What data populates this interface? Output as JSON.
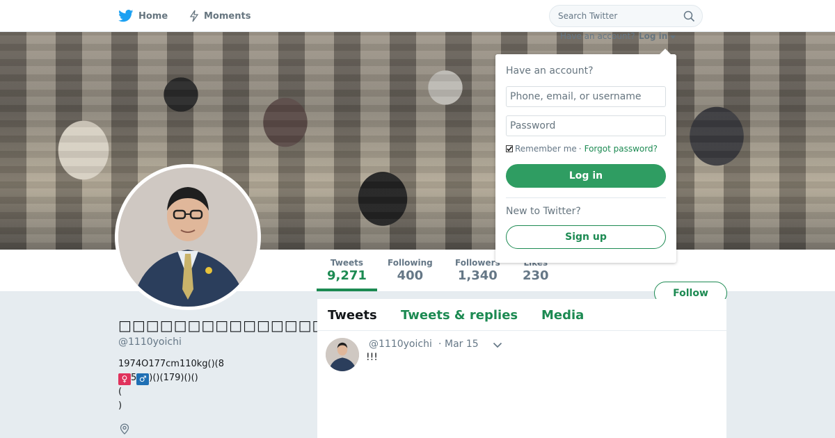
{
  "nav": {
    "home_label": "Home",
    "moments_label": "Moments",
    "search_placeholder": "Search Twitter"
  },
  "login_menu": {
    "have_account_short": "Have an account?",
    "login_link": "Log in",
    "title": "Have an account?",
    "username_placeholder": "Phone, email, or username",
    "password_placeholder": "Password",
    "remember_label": "Remember me",
    "separator": "·",
    "forgot_label": "Forgot password?",
    "login_button": "Log in",
    "new_label": "New to Twitter?",
    "signup_button": "Sign up"
  },
  "stats": [
    {
      "label": "Tweets",
      "value": "9,271",
      "active": true
    },
    {
      "label": "Following",
      "value": "400",
      "active": false
    },
    {
      "label": "Followers",
      "value": "1,340",
      "active": false
    },
    {
      "label": "Likes",
      "value": "230",
      "active": false
    }
  ],
  "follow_button": "Follow",
  "profile": {
    "name": "",
    "handle": "@1110yoichi",
    "bio_line1": "1974O177cm110kg()(8",
    "bio_female_emoji": "♀",
    "bio_mid": "5",
    "bio_male_emoji": "♂",
    "bio_end": ")()(179)()()",
    "bio_line3": "(",
    "bio_line4": ")"
  },
  "timeline": {
    "tabs": [
      "Tweets",
      "Tweets & replies",
      "Media"
    ],
    "tweet": {
      "handle": "@1110yoichi",
      "separator": "·",
      "date": "Mar 15",
      "text": "!!!"
    }
  },
  "colors": {
    "accent": "#1c8a52",
    "twitter_blue": "#1da1f2",
    "background": "#e6ecf0"
  },
  "icons": {
    "home": "twitter-bird-icon",
    "moments": "lightning-icon",
    "search": "search-icon",
    "location": "location-pin-icon",
    "caret": "chevron-down-icon"
  }
}
